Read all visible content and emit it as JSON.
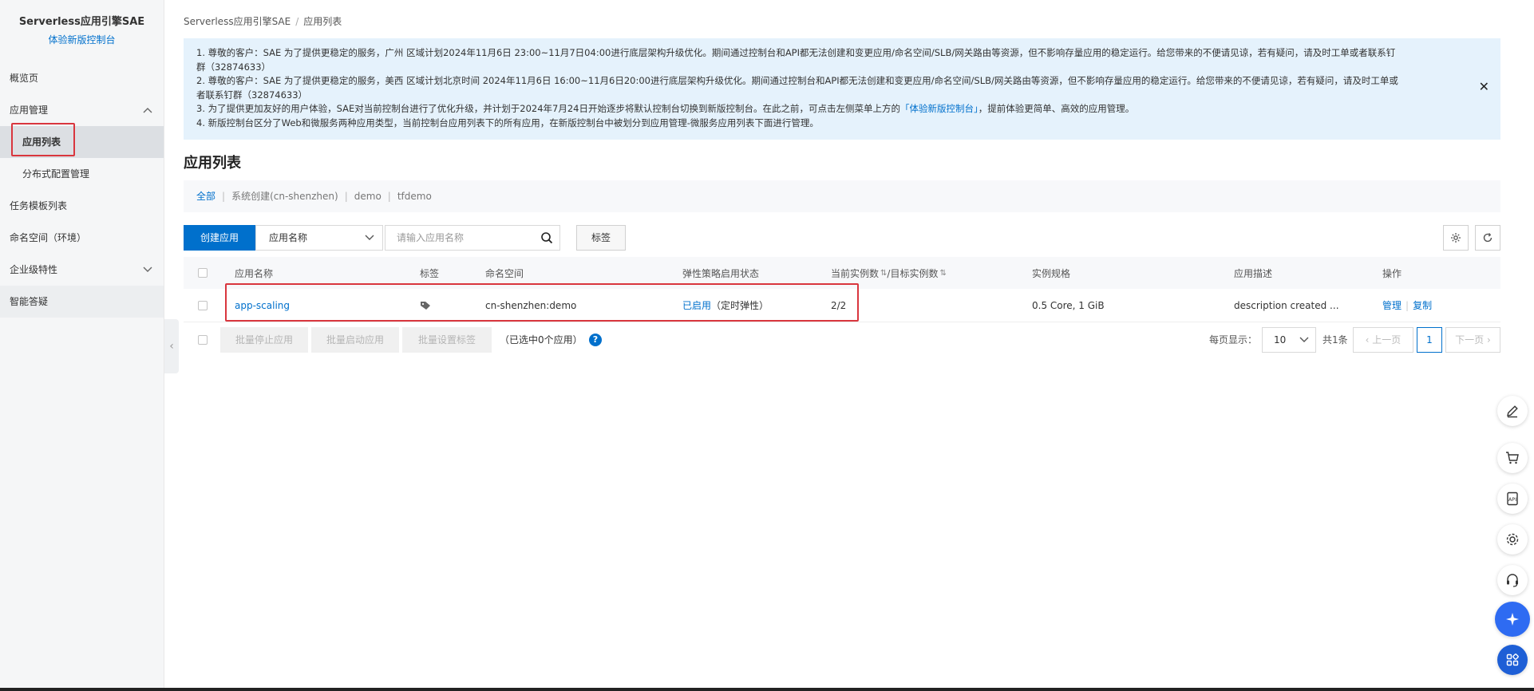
{
  "sidebar": {
    "title": "Serverless应用引擎SAE",
    "subtitle_link": "体验新版控制台",
    "items": [
      {
        "label": "概览页"
      },
      {
        "label": "应用管理"
      },
      {
        "label": "应用列表"
      },
      {
        "label": "分布式配置管理"
      },
      {
        "label": "任务模板列表"
      },
      {
        "label": "命名空间（环境）"
      },
      {
        "label": "企业级特性"
      },
      {
        "label": "智能答疑"
      }
    ]
  },
  "breadcrumb": {
    "root": "Serverless应用引擎SAE",
    "sep": "/",
    "current": "应用列表"
  },
  "notice": {
    "line1": "1. 尊敬的客户：SAE 为了提供更稳定的服务，广州 区域计划2024年11月6日 23:00~11月7日04:00进行底层架构升级优化。期间通过控制台和API都无法创建和变更应用/命名空间/SLB/网关路由等资源，但不影响存量应用的稳定运行。给您带来的不便请见谅，若有疑问，请及时工单或者联系钉",
    "line1b": "群（32874633）",
    "line2": "2. 尊敬的客户：SAE 为了提供更稳定的服务，美西 区域计划北京时间 2024年11月6日 16:00~11月6日20:00进行底层架构升级优化。期间通过控制台和API都无法创建和变更应用/命名空间/SLB/网关路由等资源，但不影响存量应用的稳定运行。给您带来的不便请见谅，若有疑问，请及时工单或",
    "line2b": "者联系钉群（32874633）",
    "line3a": "3. 为了提供更加友好的用户体验，SAE对当前控制台进行了优化升级，并计划于2024年7月24日开始逐步将默认控制台切换到新版控制台。在此之前，可点击左侧菜单上方的",
    "line3link": "「体验新版控制台」",
    "line3b": "，提前体验更简单、高效的应用管理。",
    "line4": "4. 新版控制台区分了Web和微服务两种应用类型，当前控制台应用列表下的所有应用，在新版控制台中被划分到应用管理-微服务应用列表下面进行管理。",
    "close": "✕"
  },
  "page_title": "应用列表",
  "filters": [
    "全部",
    "系统创建(cn-shenzhen)",
    "demo",
    "tfdemo"
  ],
  "filter_sep": "|",
  "toolbar": {
    "create_label": "创建应用",
    "select_value": "应用名称",
    "search_placeholder": "请输入应用名称",
    "tag_label": "标签"
  },
  "table": {
    "headers": {
      "name": "应用名称",
      "tag": "标签",
      "namespace": "命名空间",
      "elastic": "弹性策略启用状态",
      "instances_a": "当前实例数",
      "instances_b": "/目标实例数",
      "spec": "实例规格",
      "desc": "应用描述",
      "ops": "操作"
    },
    "rows": [
      {
        "name": "app-scaling",
        "namespace": "cn-shenzhen:demo",
        "elastic_status": "已启用",
        "elastic_note": "（定时弹性）",
        "instances": "2/2",
        "spec": "0.5 Core, 1 GiB",
        "desc": "description created ...",
        "op_manage": "管理",
        "op_copy": "复制"
      }
    ]
  },
  "footer": {
    "batch_stop": "批量停止应用",
    "batch_start": "批量启动应用",
    "batch_tag": "批量设置标签",
    "selected": "（已选中0个应用）",
    "help": "?",
    "per_page_label": "每页显示：",
    "per_page_value": "10",
    "total": "共1条",
    "prev": "上一页",
    "page": "1",
    "next": "下一页"
  },
  "float_tools": [
    "edit-icon",
    "cart-icon",
    "api-icon",
    "gear-icon",
    "headset-icon",
    "assistant-icon",
    "apps-grid-icon"
  ],
  "colors": {
    "accent": "#0070cc",
    "notice_bg": "#e5f2fc",
    "highlight": "#d9363e"
  }
}
